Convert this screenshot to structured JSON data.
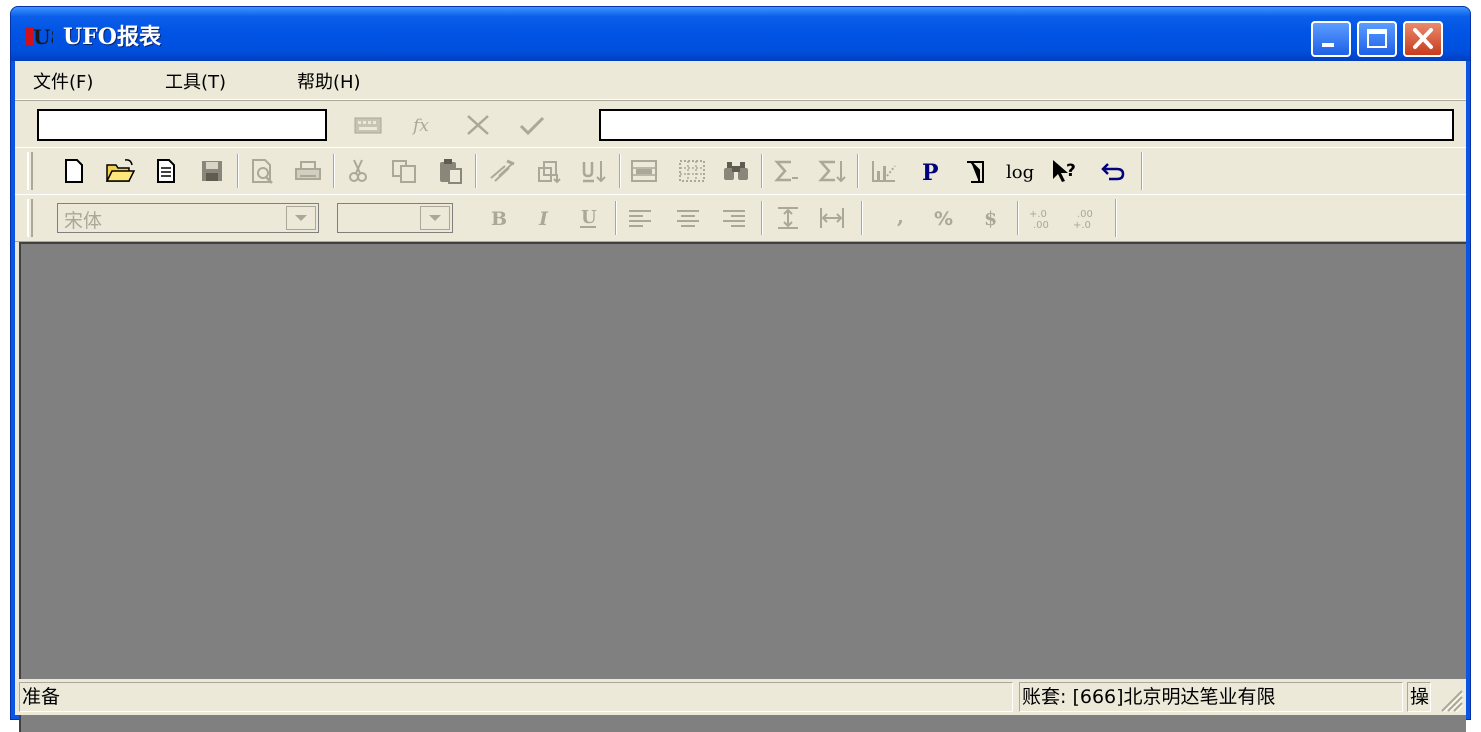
{
  "window": {
    "title": "UFO报表",
    "logo_text": "U8",
    "controls": {
      "minimize": "minimize-icon",
      "maximize": "maximize-icon",
      "close": "close-icon"
    }
  },
  "menu": [
    {
      "label": "文件(F)"
    },
    {
      "label": "工具(T)"
    },
    {
      "label": "帮助(H)"
    }
  ],
  "edit_bar": {
    "cell_name_value": "",
    "formula_value": "",
    "icons": [
      "keyboard-icon",
      "function-icon",
      "cancel-icon",
      "accept-icon"
    ],
    "fx_label": "fx"
  },
  "toolbar_standard": {
    "icons": [
      "new-file-icon",
      "open-folder-icon",
      "document-icon",
      "save-icon",
      "print-preview-icon",
      "print-icon",
      "cut-icon",
      "copy-icon",
      "paste-icon",
      "format-painter-icon",
      "insert-row-icon",
      "sort-icon",
      "merge-cells-icon",
      "grid-icon",
      "find-icon",
      "sum-icon",
      "sum-down-icon",
      "chart-icon",
      "p-icon",
      "report-icon",
      "log-icon",
      "help-pointer-icon",
      "undo-icon"
    ],
    "log_label": "log",
    "p_label": "P",
    "help_label": "?"
  },
  "toolbar_format": {
    "font_name": "宋体",
    "font_size": "",
    "bold_label": "B",
    "italic_label": "I",
    "underline_label": "U",
    "comma_label": ",",
    "percent_label": "%",
    "currency_label": "$",
    "icons": [
      "bold-icon",
      "italic-icon",
      "underline-icon",
      "align-left-icon",
      "align-center-icon",
      "align-right-icon",
      "row-height-icon",
      "column-width-icon",
      "comma-icon",
      "percent-icon",
      "currency-icon",
      "increase-decimal-icon",
      "decrease-decimal-icon"
    ]
  },
  "status": {
    "ready": "准备",
    "account": "账套: [666]北京明达笔业有限",
    "extra": "操"
  },
  "colors": {
    "titlebar": "#0053e4",
    "face": "#ece9d8",
    "workspace": "#808080",
    "disabled": "#aca899"
  }
}
